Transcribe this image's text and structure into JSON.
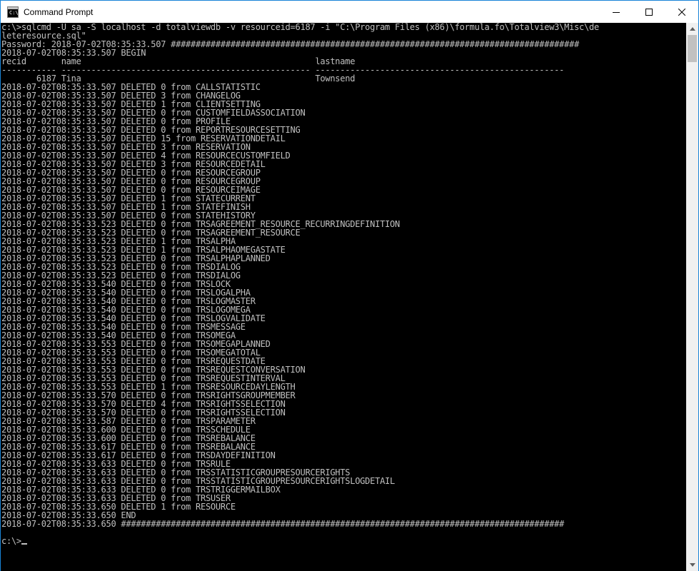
{
  "window": {
    "title": "Command Prompt",
    "icon_text": "C:\\"
  },
  "controls": {
    "minimize": "minimize-icon",
    "maximize": "maximize-icon",
    "close": "close-icon"
  },
  "console": {
    "lines": [
      "c:\\>sqlcmd -U sa -S localhost -d totalviewdb -v resourceid=6187 -i \"C:\\Program Files (x86)\\formula.fo\\Totalview3\\Misc\\de",
      "leteresource.sql\"",
      "Password: 2018-07-02T08:35:33.507 ##################################################################################",
      "2018-07-02T08:35:33.507 BEGIN",
      "recid       name                                               lastname",
      "----------- -------------------------------------------------- --------------------------------------------------",
      "       6187 Tina                                               Townsend",
      "2018-07-02T08:35:33.507 DELETED 0 from CALLSTATISTIC",
      "2018-07-02T08:35:33.507 DELETED 3 from CHANGELOG",
      "2018-07-02T08:35:33.507 DELETED 1 from CLIENTSETTING",
      "2018-07-02T08:35:33.507 DELETED 0 from CUSTOMFIELDASSOCIATION",
      "2018-07-02T08:35:33.507 DELETED 0 from PROFILE",
      "2018-07-02T08:35:33.507 DELETED 0 from REPORTRESOURCESETTING",
      "2018-07-02T08:35:33.507 DELETED 15 from RESERVATIONDETAIL",
      "2018-07-02T08:35:33.507 DELETED 3 from RESERVATION",
      "2018-07-02T08:35:33.507 DELETED 4 from RESOURCECUSTOMFIELD",
      "2018-07-02T08:35:33.507 DELETED 3 from RESOURCEDETAIL",
      "2018-07-02T08:35:33.507 DELETED 0 from RESOURCEGROUP",
      "2018-07-02T08:35:33.507 DELETED 0 from RESOURCEGROUP",
      "2018-07-02T08:35:33.507 DELETED 0 from RESOURCEIMAGE",
      "2018-07-02T08:35:33.507 DELETED 1 from STATECURRENT",
      "2018-07-02T08:35:33.507 DELETED 1 from STATEFINISH",
      "2018-07-02T08:35:33.507 DELETED 0 from STATEHISTORY",
      "2018-07-02T08:35:33.523 DELETED 0 from TRSAGREEMENT_RESOURCE_RECURRINGDEFINITION",
      "2018-07-02T08:35:33.523 DELETED 0 from TRSAGREEMENT_RESOURCE",
      "2018-07-02T08:35:33.523 DELETED 1 from TRSALPHA",
      "2018-07-02T08:35:33.523 DELETED 1 from TRSALPHAOMEGASTATE",
      "2018-07-02T08:35:33.523 DELETED 0 from TRSALPHAPLANNED",
      "2018-07-02T08:35:33.523 DELETED 0 from TRSDIALOG",
      "2018-07-02T08:35:33.523 DELETED 0 from TRSDIALOG",
      "2018-07-02T08:35:33.540 DELETED 0 from TRSLOCK",
      "2018-07-02T08:35:33.540 DELETED 0 from TRSLOGALPHA",
      "2018-07-02T08:35:33.540 DELETED 0 from TRSLOGMASTER",
      "2018-07-02T08:35:33.540 DELETED 0 from TRSLOGOMEGA",
      "2018-07-02T08:35:33.540 DELETED 0 from TRSLOGVALIDATE",
      "2018-07-02T08:35:33.540 DELETED 0 from TRSMESSAGE",
      "2018-07-02T08:35:33.540 DELETED 0 from TRSOMEGA",
      "2018-07-02T08:35:33.553 DELETED 0 from TRSOMEGAPLANNED",
      "2018-07-02T08:35:33.553 DELETED 0 from TRSOMEGATOTAL",
      "2018-07-02T08:35:33.553 DELETED 0 from TRSREQUESTDATE",
      "2018-07-02T08:35:33.553 DELETED 0 from TRSREQUESTCONVERSATION",
      "2018-07-02T08:35:33.553 DELETED 0 from TRSREQUESTINTERVAL",
      "2018-07-02T08:35:33.553 DELETED 1 from TRSRESOURCEDAYLENGTH",
      "2018-07-02T08:35:33.570 DELETED 0 from TRSRIGHTSGROUPMEMBER",
      "2018-07-02T08:35:33.570 DELETED 4 from TRSRIGHTSSELECTION",
      "2018-07-02T08:35:33.570 DELETED 0 from TRSRIGHTSSELECTION",
      "2018-07-02T08:35:33.587 DELETED 0 from TRSPARAMETER",
      "2018-07-02T08:35:33.600 DELETED 0 from TRSSCHEDULE",
      "2018-07-02T08:35:33.600 DELETED 0 from TRSREBALANCE",
      "2018-07-02T08:35:33.617 DELETED 0 from TRSREBALANCE",
      "2018-07-02T08:35:33.617 DELETED 0 from TRSDAYDEFINITION",
      "2018-07-02T08:35:33.633 DELETED 0 from TRSRULE",
      "2018-07-02T08:35:33.633 DELETED 0 from TRSSTATISTICGROUPRESOURCERIGHTS",
      "2018-07-02T08:35:33.633 DELETED 0 from TRSSTATISTICGROUPRESOURCERIGHTSLOGDETAIL",
      "2018-07-02T08:35:33.633 DELETED 0 from TRSTRIGGERMAILBOX",
      "2018-07-02T08:35:33.633 DELETED 0 from TRSUSER",
      "2018-07-02T08:35:33.650 DELETED 1 from RESOURCE",
      "2018-07-02T08:35:33.650 END",
      "2018-07-02T08:35:33.650 #########################################################################################",
      ""
    ],
    "prompt": "c:\\>"
  },
  "colors": {
    "console_bg": "#000000",
    "console_fg": "#c0c0c0",
    "titlebar_bg": "#ffffff",
    "window_border": "#1883d7"
  }
}
